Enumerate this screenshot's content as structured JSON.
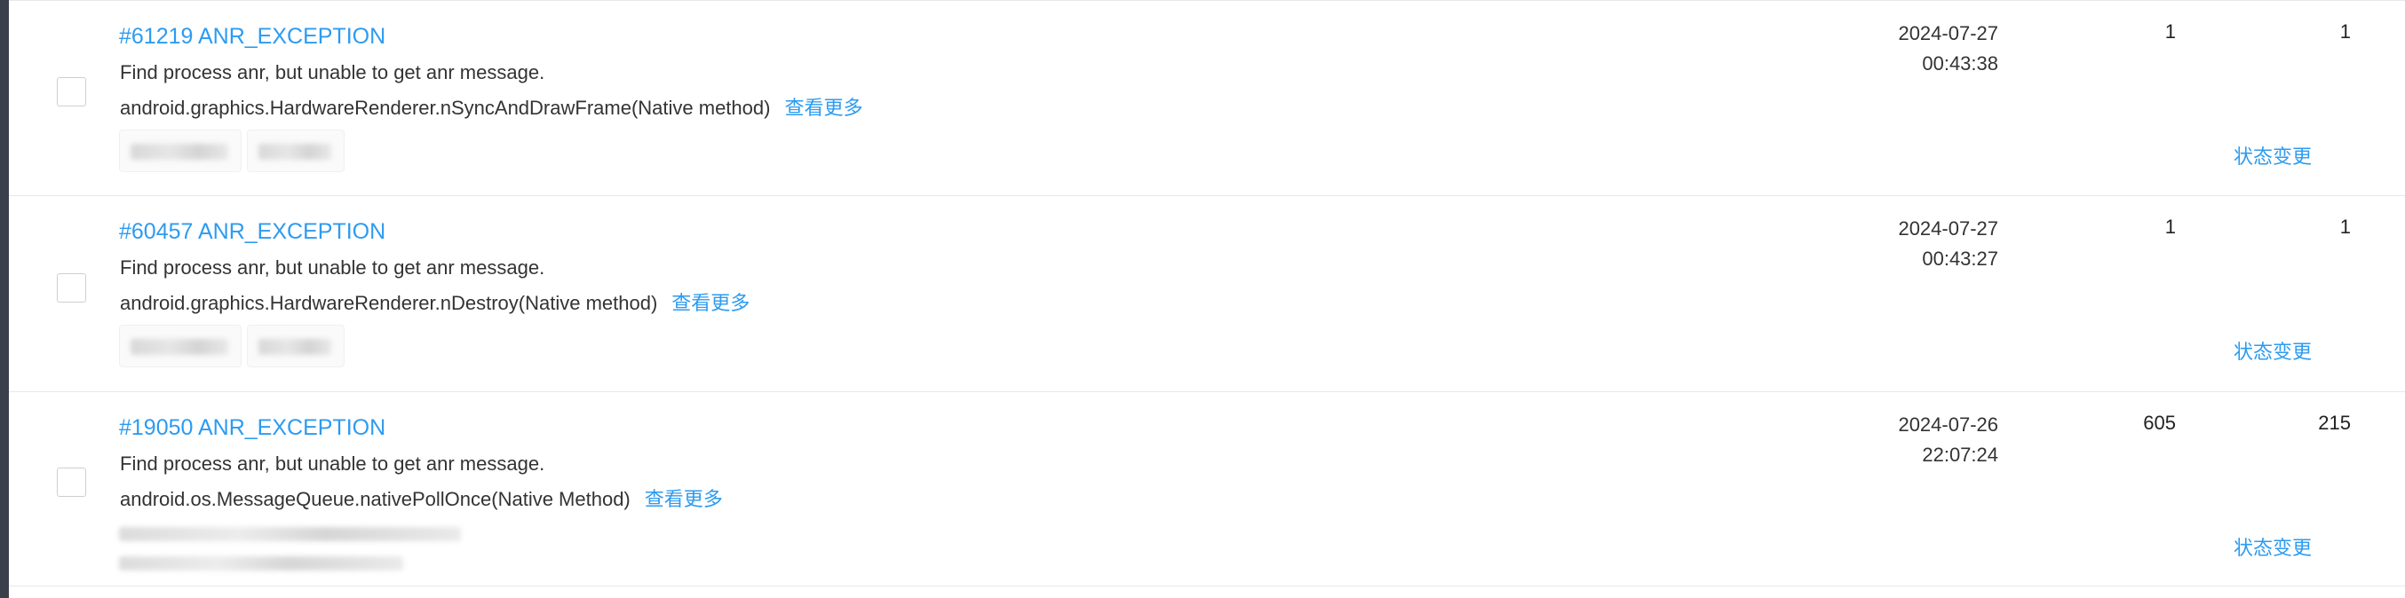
{
  "issues": [
    {
      "title": "#61219 ANR_EXCEPTION",
      "message": "Find process anr, but unable to get anr message.",
      "stack": "android.graphics.HardwareRenderer.nSyncAndDrawFrame(Native method)",
      "more_label": "查看更多",
      "date": "2024-07-27",
      "time": "00:43:38",
      "count_a": "1",
      "count_b": "1",
      "status_label": "状态变更"
    },
    {
      "title": "#60457 ANR_EXCEPTION",
      "message": "Find process anr, but unable to get anr message.",
      "stack": "android.graphics.HardwareRenderer.nDestroy(Native method)",
      "more_label": "查看更多",
      "date": "2024-07-27",
      "time": "00:43:27",
      "count_a": "1",
      "count_b": "1",
      "status_label": "状态变更"
    },
    {
      "title": "#19050 ANR_EXCEPTION",
      "message": "Find process anr, but unable to get anr message.",
      "stack": "android.os.MessageQueue.nativePollOnce(Native Method)",
      "more_label": "查看更多",
      "date": "2024-07-26",
      "time": "22:07:24",
      "count_a": "605",
      "count_b": "215",
      "status_label": "状态变更"
    }
  ]
}
